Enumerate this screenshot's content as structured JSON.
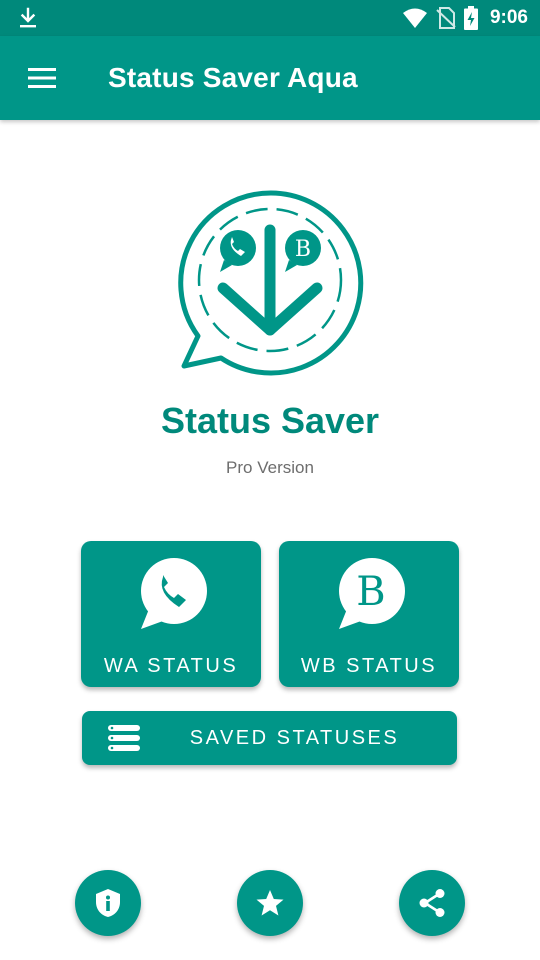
{
  "status_bar": {
    "time": "9:06",
    "icons": [
      "download-icon",
      "wifi-icon",
      "no-sim-icon",
      "battery-charging-icon"
    ]
  },
  "app_bar": {
    "title": "Status Saver Aqua",
    "menu_icon": "hamburger-menu-icon"
  },
  "hero": {
    "logo_icon": "status-saver-logo-icon",
    "app_name": "Status Saver",
    "subtitle": "Pro Version"
  },
  "tiles": [
    {
      "label": "WA STATUS",
      "icon": "whatsapp-icon"
    },
    {
      "label": "WB STATUS",
      "icon": "whatsapp-business-icon"
    }
  ],
  "saved_button": {
    "label": "SAVED STATUSES",
    "icon": "list-icon"
  },
  "bottom_actions": [
    {
      "name": "privacy",
      "icon": "shield-info-icon"
    },
    {
      "name": "rate",
      "icon": "star-icon"
    },
    {
      "name": "share",
      "icon": "share-icon"
    }
  ],
  "colors": {
    "primary": "#009688",
    "primary_dark": "#00897b",
    "subtitle_gray": "#6d6d6d",
    "background": "#ffffff"
  }
}
